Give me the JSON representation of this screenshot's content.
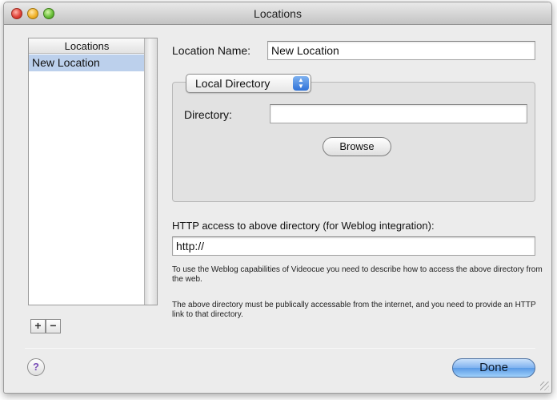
{
  "window": {
    "title": "Locations"
  },
  "list": {
    "header": "Locations",
    "items": [
      {
        "label": "New Location",
        "selected": true
      }
    ],
    "add_label": "+",
    "remove_label": "−"
  },
  "location": {
    "name_label": "Location Name:",
    "name_value": "New Location",
    "type_selected": "Local Directory",
    "directory_label": "Directory:",
    "directory_value": "",
    "browse_label": "Browse"
  },
  "http": {
    "label": "HTTP access to above directory (for Weblog integration):",
    "value": "http://",
    "help1": "To use the Weblog capabilities of Videocue you need to describe how to access the above directory from the web.",
    "help2": "The above directory must be publically accessable from the internet, and you need to provide an HTTP link to that directory."
  },
  "footer": {
    "help_label": "?",
    "done_label": "Done"
  },
  "colors": {
    "selection": "#bcd0ec",
    "default_button": "#5b9be6",
    "window_bg": "#ececec"
  },
  "icons": {
    "close": "close-icon",
    "minimize": "minimize-icon",
    "zoom": "zoom-icon",
    "popup_arrows": "updown-arrows-icon",
    "resize": "resize-grip-icon",
    "help": "help-icon"
  }
}
